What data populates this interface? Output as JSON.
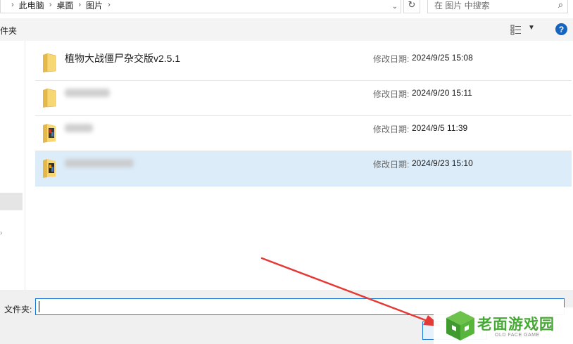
{
  "address_bar": {
    "breadcrumbs": [
      "此电脑",
      "桌面",
      "图片"
    ]
  },
  "search": {
    "placeholder": "在 图片 中搜索"
  },
  "toolbar": {
    "new_folder_label": "件夹"
  },
  "files": [
    {
      "name": "植物大战僵尸杂交版v2.5.1",
      "date_label": "修改日期:",
      "date": "2024/9/25 15:08",
      "icon": "folder-icon",
      "redacted": false,
      "selected": false
    },
    {
      "name": "",
      "date_label": "修改日期:",
      "date": "2024/9/20 15:11",
      "icon": "folder-icon",
      "redacted": true,
      "selected": false
    },
    {
      "name": "",
      "date_label": "修改日期:",
      "date": "2024/9/5 11:39",
      "icon": "image-folder-icon",
      "redacted": true,
      "selected": false
    },
    {
      "name": "",
      "date_label": "修改日期:",
      "date": "2024/9/23 15:10",
      "icon": "image-folder-icon",
      "redacted": true,
      "selected": true
    }
  ],
  "bottom": {
    "folder_label": "文件夹:",
    "folder_value": ""
  },
  "watermark": {
    "text": "老面游戏园",
    "subtext": "OLD FACE GAME"
  },
  "colors": {
    "selection": "#dcecf9",
    "accent": "#1976d2",
    "arrow": "#e53935",
    "watermark": "#46a935"
  }
}
